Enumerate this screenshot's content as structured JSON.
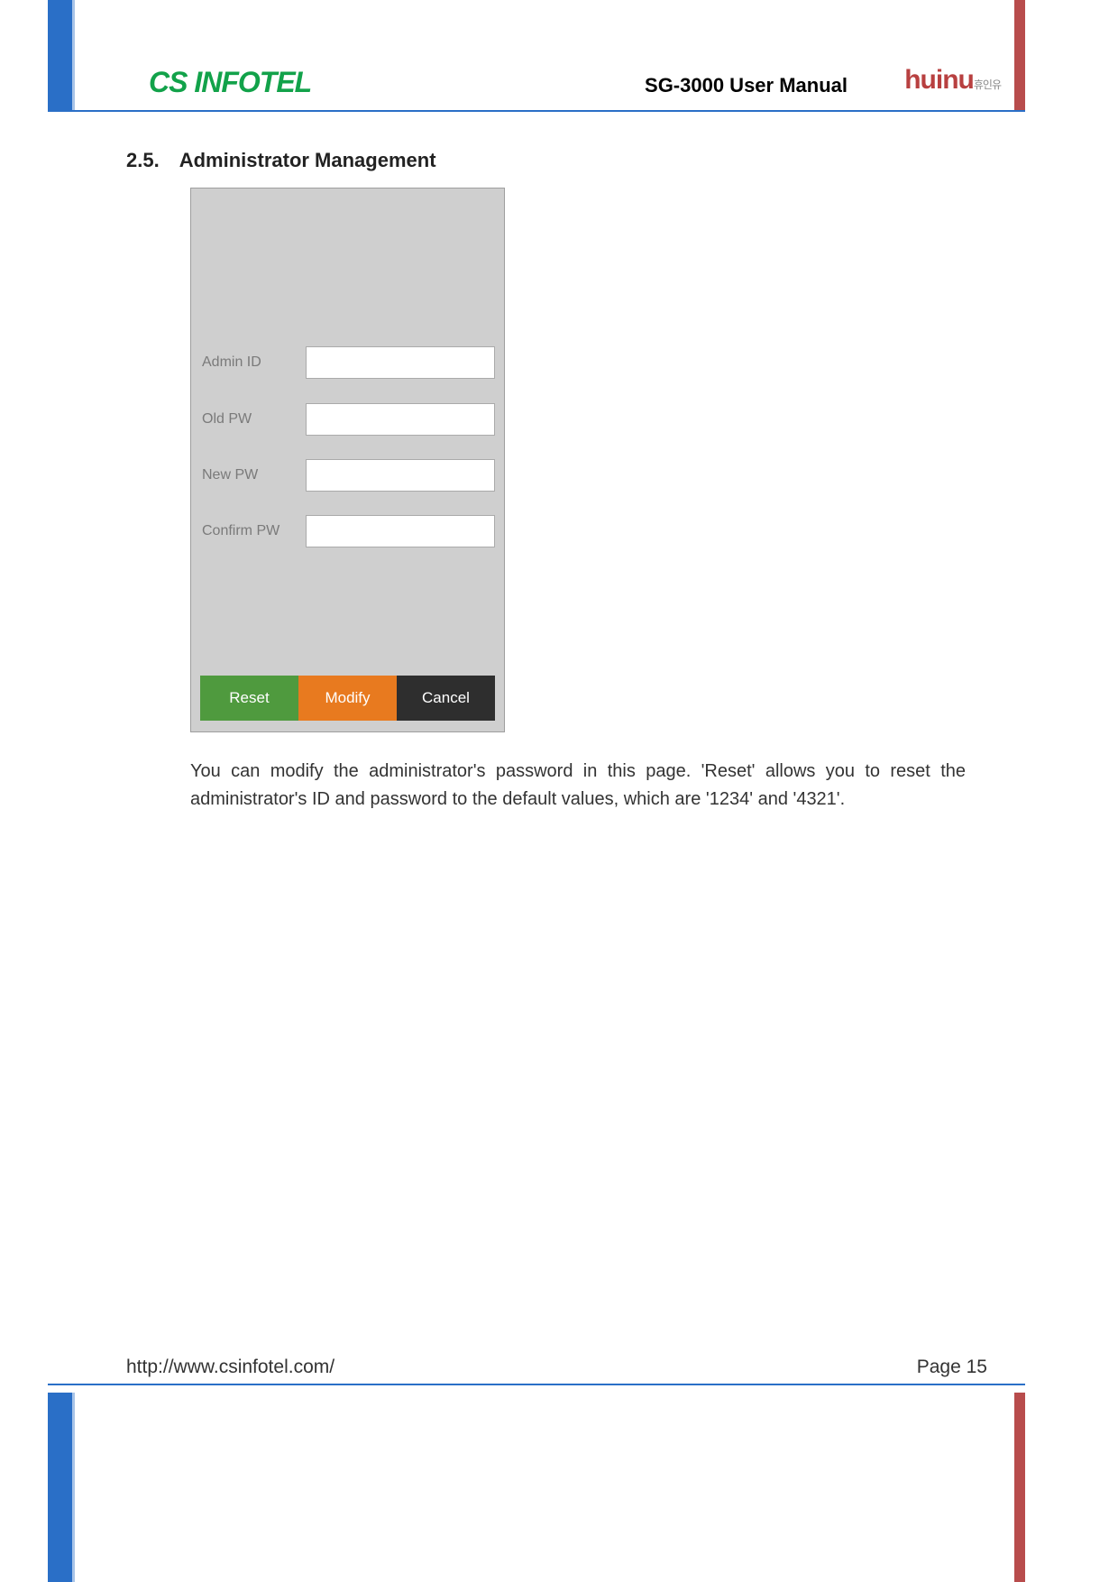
{
  "header": {
    "logo_left": "CS INFOTEL",
    "title": "SG-3000 User Manual",
    "logo_right": "huinu",
    "logo_right_sub": "휴인유"
  },
  "section": {
    "number": "2.5.",
    "title": "Administrator Management"
  },
  "form": {
    "admin_id_label": "Admin ID",
    "old_pw_label": "Old PW",
    "new_pw_label": "New PW",
    "confirm_pw_label": "Confirm PW"
  },
  "buttons": {
    "reset": "Reset",
    "modify": "Modify",
    "cancel": "Cancel"
  },
  "paragraph": "You can modify the administrator's password in this page. 'Reset' allows you to reset the administrator's ID and password to the default values, which are '1234' and '4321'.",
  "footer": {
    "url": "http://www.csinfotel.com/",
    "page": "Page 15"
  }
}
